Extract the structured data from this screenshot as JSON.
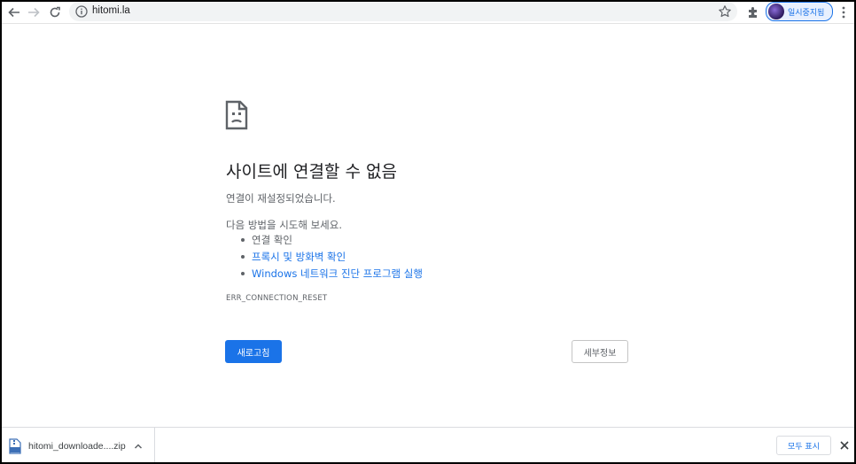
{
  "toolbar": {
    "url": "hitomi.la",
    "profile_label": "일시중지됨"
  },
  "error": {
    "title": "사이트에 연결할 수 없음",
    "description": "연결이 재설정되었습니다.",
    "suggestions_heading": "다음 방법을 시도해 보세요.",
    "suggestions": [
      {
        "text": "연결 확인",
        "link": false
      },
      {
        "text": "프록시 및 방화벽 확인",
        "link": true
      },
      {
        "text": "Windows 네트워크 진단 프로그램 실행",
        "link": true
      }
    ],
    "code": "ERR_CONNECTION_RESET",
    "reload_label": "새로고침",
    "details_label": "세부정보"
  },
  "downloads": {
    "file_name": "hitomi_downloade....zip",
    "show_all_label": "모두 표시"
  },
  "colors": {
    "accent": "#1a73e8",
    "text_secondary": "#5f6368"
  }
}
